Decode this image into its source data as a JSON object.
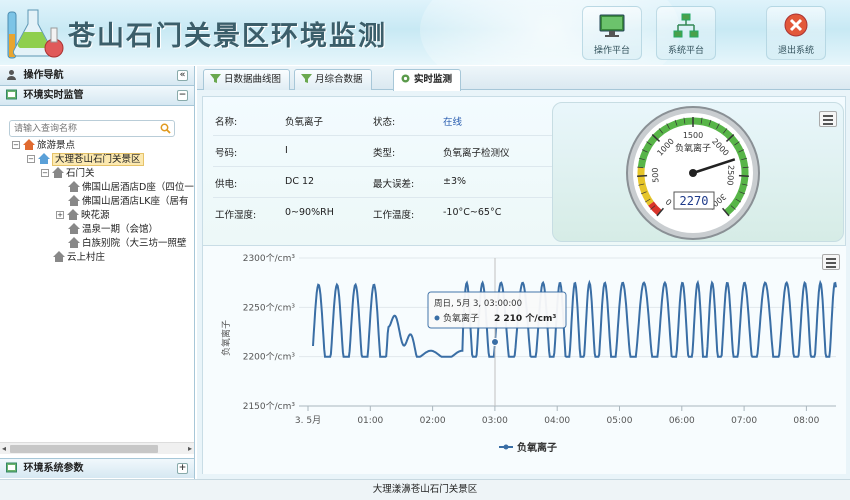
{
  "header": {
    "title": "苍山石门关景区环境监测",
    "buttons": [
      {
        "label": "操作平台",
        "icon": "monitor-icon"
      },
      {
        "label": "系统平台",
        "icon": "network-icon"
      },
      {
        "label": "退出系统",
        "icon": "exit-icon"
      }
    ]
  },
  "sidebar": {
    "nav_title": "操作导航",
    "section_title": "环境实时监管",
    "search_placeholder": "请输入查询名称",
    "tree": [
      {
        "label": "旅游景点",
        "depth": 0,
        "toggle": "⊟",
        "icon": "scenic-icon"
      },
      {
        "label": "大理苍山石门关景区",
        "depth": 1,
        "toggle": "⊟",
        "icon": "home-icon",
        "selected": true
      },
      {
        "label": "石门关",
        "depth": 2,
        "toggle": "⊟",
        "icon": "house-icon"
      },
      {
        "label": "佛国山居酒店D座（四位一",
        "depth": 3,
        "toggle": "",
        "icon": "house-icon"
      },
      {
        "label": "佛国山居酒店LK座（居有",
        "depth": 3,
        "toggle": "",
        "icon": "house-icon"
      },
      {
        "label": "映花源",
        "depth": 2,
        "toggle": "⊞",
        "icon": "house-icon"
      },
      {
        "label": "温泉一期（会馆）",
        "depth": 3,
        "toggle": "",
        "icon": "house-icon"
      },
      {
        "label": "白族别院（大三坊一照壁",
        "depth": 3,
        "toggle": "",
        "icon": "house-icon"
      },
      {
        "label": "云上村庄",
        "depth": 1,
        "toggle": "",
        "icon": "house-icon"
      }
    ],
    "footer_title": "环境系统参数"
  },
  "tabs": [
    {
      "label": "日数据曲线图",
      "icon": "filter-icon",
      "active": false
    },
    {
      "label": "月综合数据",
      "icon": "filter-icon",
      "active": false
    },
    {
      "label": "实时监测",
      "icon": "gear-icon",
      "active": true
    }
  ],
  "device": {
    "name_label": "名称:",
    "name_value": "负氧离子",
    "status_label": "状态:",
    "status_value": "在线",
    "code_label": "号码:",
    "code_value": "I",
    "type_label": "类型:",
    "type_value": "负氧离子检测仪",
    "power_label": "供电:",
    "power_value": "DC 12",
    "error_label": "最大误差:",
    "error_value": "±3%",
    "humidity_label": "工作湿度:",
    "humidity_value": "0~90%RH",
    "temp_label": "工作温度:",
    "temp_value": "-10°C~65°C"
  },
  "gauge": {
    "title": "负氧离子",
    "value": 2270,
    "display": "2270",
    "min": 0,
    "max": 3000,
    "ticks": [
      "0",
      "500",
      "1000",
      "1500",
      "2000",
      "2500",
      "3000"
    ]
  },
  "chart_data": {
    "type": "line",
    "ylabel": "负氧离子",
    "yticks": [
      "2300个/cm³",
      "2250个/cm³",
      "2200个/cm³",
      "2150个/cm³"
    ],
    "xticks": [
      "3. 5月",
      "01:00",
      "02:00",
      "03:00",
      "04:00",
      "05:00",
      "06:00",
      "07:00",
      "08:00"
    ],
    "ylim": [
      2150,
      2300
    ],
    "series": [
      {
        "name": "负氧离子",
        "color": "#3a6ea5"
      }
    ],
    "tooltip": {
      "date": "周日, 5月 3, 03:00:00",
      "series": "负氧离子",
      "value": "2 210 个/cm³"
    },
    "legend": "负氧离子"
  },
  "footer": {
    "text": "大理漾濞苍山石门关景区"
  }
}
